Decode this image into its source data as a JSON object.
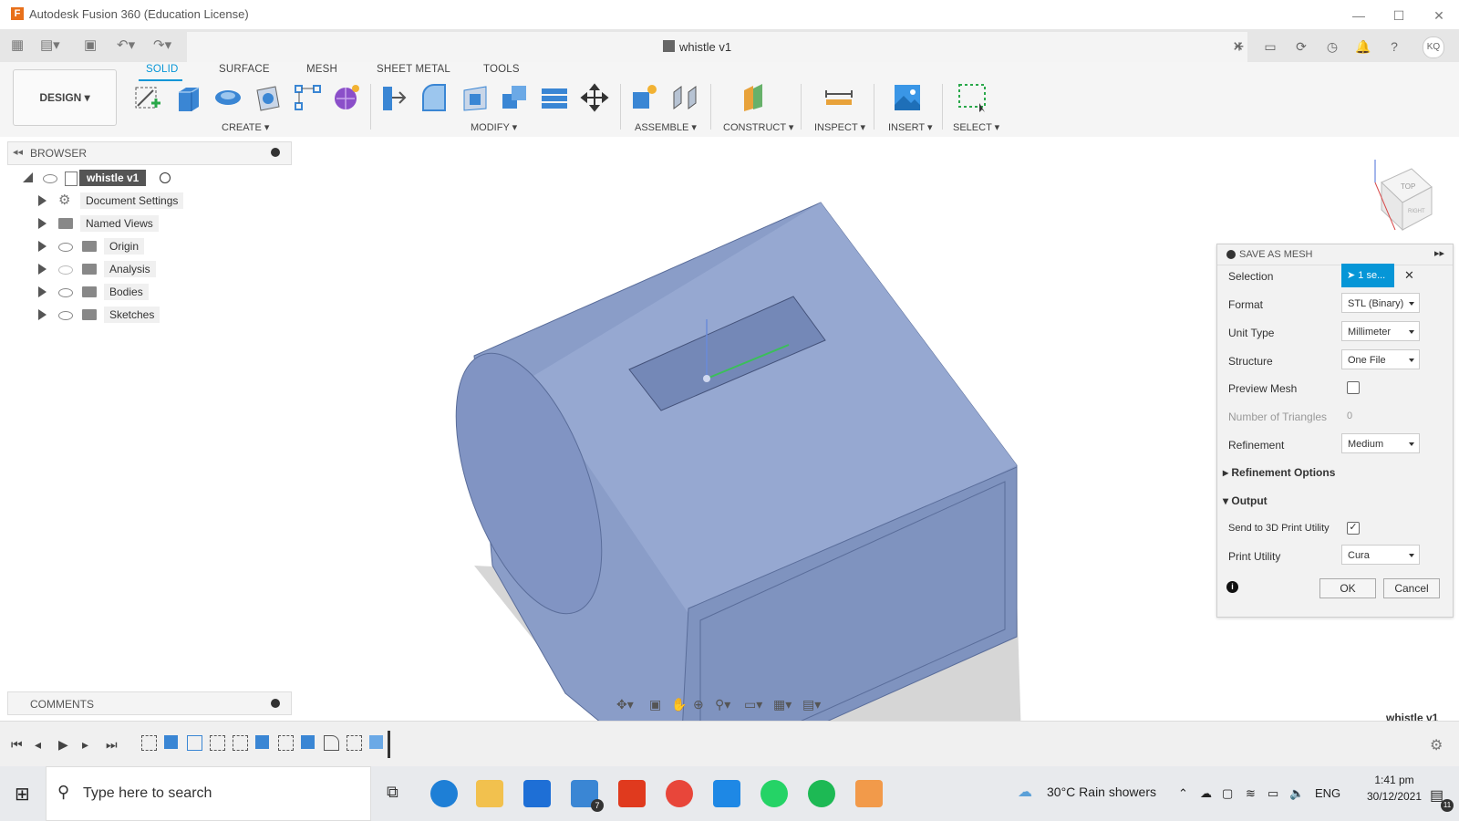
{
  "window": {
    "title": "Autodesk Fusion 360 (Education License)"
  },
  "document": {
    "tab_name": "whistle v1"
  },
  "appbar": {
    "user_initials": "KQ"
  },
  "toolbar": {
    "design_label": "DESIGN ▾",
    "tabs": [
      "SOLID",
      "SURFACE",
      "MESH",
      "SHEET METAL",
      "TOOLS"
    ],
    "active_tab": "SOLID",
    "groups": [
      "CREATE ▾",
      "MODIFY ▾",
      "ASSEMBLE ▾",
      "CONSTRUCT ▾",
      "INSPECT ▾",
      "INSERT ▾",
      "SELECT ▾"
    ]
  },
  "browser": {
    "title": "BROWSER",
    "root": "whistle v1",
    "items": [
      "Document Settings",
      "Named Views",
      "Origin",
      "Analysis",
      "Bodies",
      "Sketches"
    ]
  },
  "dialog": {
    "title": "SAVE AS MESH",
    "selection_label": "Selection",
    "selection_value": "1 se...",
    "format_label": "Format",
    "format_value": "STL (Binary)",
    "unit_label": "Unit Type",
    "unit_value": "Millimeter",
    "structure_label": "Structure",
    "structure_value": "One File",
    "preview_label": "Preview Mesh",
    "preview_checked": false,
    "triangles_label": "Number of Triangles",
    "triangles_value": "0",
    "refinement_label": "Refinement",
    "refinement_value": "Medium",
    "refinement_options_label": "Refinement Options",
    "output_label": "Output",
    "send_label": "Send to 3D Print Utility",
    "send_checked": true,
    "print_utility_label": "Print Utility",
    "print_utility_value": "Cura",
    "ok_label": "OK",
    "cancel_label": "Cancel"
  },
  "comments": {
    "title": "COMMENTS"
  },
  "viewport": {
    "model_label": "whistle v1",
    "viewcube_top": "TOP",
    "viewcube_right": "RIGHT"
  },
  "taskbar": {
    "search_placeholder": "Type here to search",
    "weather": "30°C  Rain showers",
    "language": "ENG",
    "time": "1:41 pm",
    "date": "30/12/2021",
    "mail_badge": "7",
    "notification_badge": "11"
  },
  "colors": {
    "accent": "#0696d7",
    "model": "#8a9dc8",
    "brand": "#e8701a"
  }
}
